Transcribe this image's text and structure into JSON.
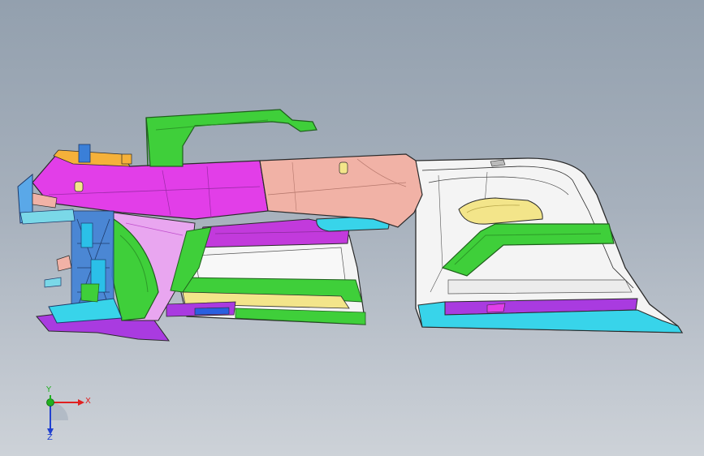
{
  "viewport": {
    "background_top": "#93a0ae",
    "background_bottom": "#cdd2d8"
  },
  "model": {
    "colors": {
      "magenta": "#e23ee8",
      "purple": "#a93be0",
      "pink": "#f1b2a6",
      "green": "#3fcf3a",
      "dark_green": "#1f8a1c",
      "cyan": "#38d4ea",
      "yellow": "#f3e58a",
      "white_panel": "#f4f4f4",
      "orange": "#f5b13a",
      "blue": "#2a5fe0",
      "outline": "#2a2a2a"
    }
  },
  "triad": {
    "x_label": "X",
    "y_label": "Y",
    "z_label": "Z",
    "x_color": "#e02020",
    "y_color": "#20b020",
    "z_color": "#2040d0"
  }
}
